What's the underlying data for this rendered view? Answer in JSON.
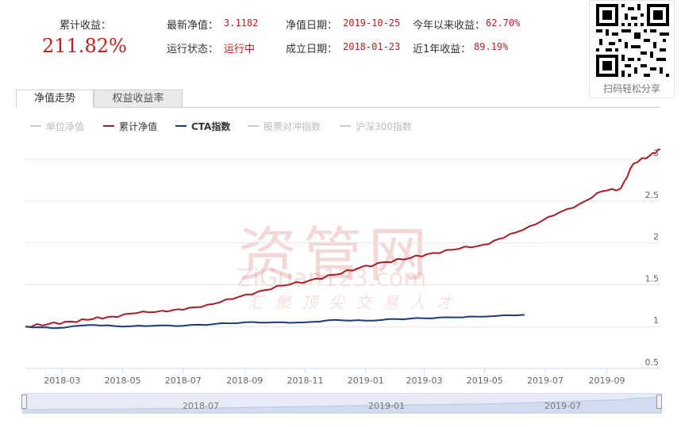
{
  "header": {
    "cumulative_return_label": "累计收益：",
    "cumulative_return_value": "211.82%",
    "latest_nav_label": "最新净值：",
    "latest_nav_value": "3.1182",
    "status_label": "运行状态：",
    "status_value": "运行中",
    "nav_date_label": "净值日期：",
    "nav_date_value": "2019-10-25",
    "inception_label": "成立日期：",
    "inception_value": "2018-01-23",
    "ytd_label": "今年以来收益：",
    "ytd_value": "62.70%",
    "one_year_label": "近1年收益：",
    "one_year_value": "89.19%"
  },
  "qr": {
    "caption": "扫码轻松分享"
  },
  "tabs": [
    {
      "label": "净值走势",
      "active": true
    },
    {
      "label": "权益收益率",
      "active": false
    }
  ],
  "legend": [
    {
      "label": "单位净值",
      "color": "#cccccc",
      "active": false
    },
    {
      "label": "累计净值",
      "color": "#aa1b22",
      "active": true
    },
    {
      "label": "CTA指数",
      "color": "#1a3c7a",
      "active": true
    },
    {
      "label": "股票对冲指数",
      "color": "#cccccc",
      "active": false
    },
    {
      "label": "沪深300指数",
      "color": "#cccccc",
      "active": false
    }
  ],
  "watermark": {
    "name": "资管网",
    "url": "ZiGuan123.com",
    "slogan": "汇聚顶尖交易人才"
  },
  "chart_data": {
    "type": "line",
    "ylim": [
      0.5,
      3.2
    ],
    "yticks": [
      0.5,
      1,
      1.5,
      2,
      2.5,
      3
    ],
    "ytick_labels": [
      "0.5",
      "1",
      "1.5",
      "2",
      "2.5",
      "3"
    ],
    "xlim": [
      "2018-01-23",
      "2019-10-25"
    ],
    "xticks": [
      "2018-03",
      "2018-05",
      "2018-07",
      "2018-09",
      "2018-11",
      "2019-01",
      "2019-03",
      "2019-05",
      "2019-07",
      "2019-09"
    ],
    "grid": "horizontal",
    "series": [
      {
        "name": "累计净值",
        "color": "#aa1b22",
        "points": [
          [
            "2018-01-23",
            1.0
          ],
          [
            "2018-02-15",
            1.03
          ],
          [
            "2018-03-10",
            1.06
          ],
          [
            "2018-04-01",
            1.09
          ],
          [
            "2018-04-20",
            1.12
          ],
          [
            "2018-05-15",
            1.16
          ],
          [
            "2018-06-10",
            1.19
          ],
          [
            "2018-07-01",
            1.2
          ],
          [
            "2018-07-25",
            1.26
          ],
          [
            "2018-08-20",
            1.33
          ],
          [
            "2018-09-15",
            1.42
          ],
          [
            "2018-10-10",
            1.49
          ],
          [
            "2018-11-05",
            1.55
          ],
          [
            "2018-12-01",
            1.62
          ],
          [
            "2018-12-25",
            1.7
          ],
          [
            "2019-01-20",
            1.77
          ],
          [
            "2019-02-15",
            1.82
          ],
          [
            "2019-03-10",
            1.88
          ],
          [
            "2019-04-05",
            1.93
          ],
          [
            "2019-04-30",
            1.98
          ],
          [
            "2019-05-20",
            2.06
          ],
          [
            "2019-06-15",
            2.2
          ],
          [
            "2019-07-10",
            2.33
          ],
          [
            "2019-08-05",
            2.47
          ],
          [
            "2019-08-28",
            2.62
          ],
          [
            "2019-09-15",
            2.65
          ],
          [
            "2019-09-28",
            2.95
          ],
          [
            "2019-10-15",
            3.05
          ],
          [
            "2019-10-25",
            3.12
          ]
        ]
      },
      {
        "name": "CTA指数",
        "color": "#1a3c7a",
        "points": [
          [
            "2018-01-23",
            1.0
          ],
          [
            "2018-02-20",
            0.98
          ],
          [
            "2018-04-01",
            1.02
          ],
          [
            "2018-05-01",
            1.0
          ],
          [
            "2018-06-01",
            1.01
          ],
          [
            "2018-07-01",
            1.01
          ],
          [
            "2018-08-01",
            1.03
          ],
          [
            "2018-09-01",
            1.05
          ],
          [
            "2018-10-01",
            1.05
          ],
          [
            "2018-11-01",
            1.05
          ],
          [
            "2018-12-01",
            1.08
          ],
          [
            "2019-01-01",
            1.07
          ],
          [
            "2019-02-01",
            1.09
          ],
          [
            "2019-03-01",
            1.1
          ],
          [
            "2019-04-01",
            1.11
          ],
          [
            "2019-05-01",
            1.12
          ],
          [
            "2019-06-10",
            1.14
          ]
        ]
      }
    ]
  },
  "navigator": {
    "ticks": [
      "2018-07",
      "2019-01",
      "2019-07"
    ]
  }
}
